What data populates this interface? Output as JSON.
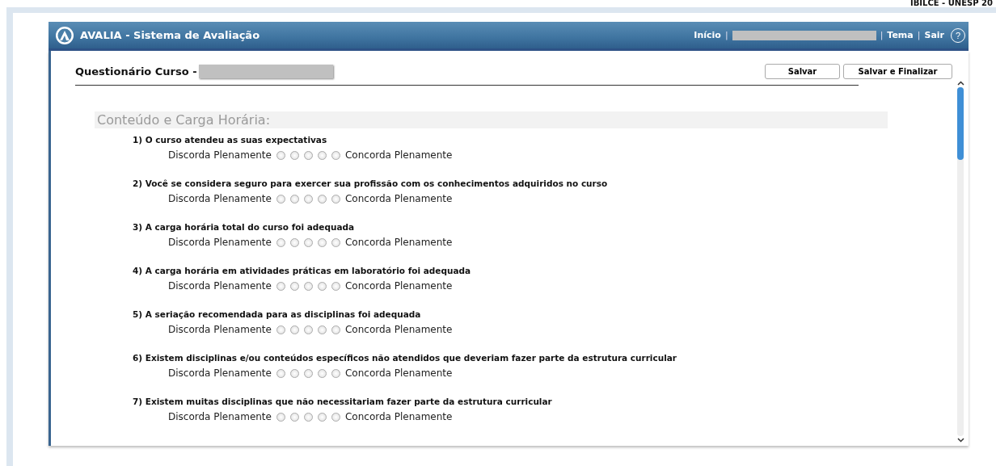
{
  "corner_text": "IBILCE - UNESP 20",
  "header": {
    "title": "AVALIA - Sistema de Avaliação",
    "links": [
      "Início",
      "Tema",
      "Sair"
    ],
    "separator": "|",
    "help": "?"
  },
  "form": {
    "title": "Questionário Curso -",
    "buttons": [
      "Salvar",
      "Salvar e Finalizar"
    ],
    "section": "Conteúdo e Carga Horária:",
    "questions": [
      {
        "text": "1) O curso atendeu as suas expectativas",
        "low": "Discorda Plenamente",
        "high": "Concorda Plenamente",
        "options": [
          {
            "selected": false
          },
          {
            "selected": false
          },
          {
            "selected": false
          },
          {
            "selected": false
          },
          {
            "selected": false
          }
        ]
      },
      {
        "text": "2) Você se considera seguro para exercer sua profissão com os conhecimentos adquiridos no curso",
        "low": "Discorda Plenamente",
        "high": "Concorda Plenamente",
        "options": [
          {
            "selected": false
          },
          {
            "selected": false
          },
          {
            "selected": false
          },
          {
            "selected": false
          },
          {
            "selected": false
          }
        ]
      },
      {
        "text": "3) A carga horária total do curso foi adequada",
        "low": "Discorda Plenamente",
        "high": "Concorda Plenamente",
        "options": [
          {
            "selected": false
          },
          {
            "selected": false
          },
          {
            "selected": false
          },
          {
            "selected": false
          },
          {
            "selected": false
          }
        ]
      },
      {
        "text": "4) A carga horária em atividades práticas em laboratório foi adequada",
        "low": "Discorda Plenamente",
        "high": "Concorda Plenamente",
        "options": [
          {
            "selected": false
          },
          {
            "selected": false
          },
          {
            "selected": false
          },
          {
            "selected": false
          },
          {
            "selected": false
          }
        ]
      },
      {
        "text": "5) A seriação recomendada para as disciplinas foi adequada",
        "low": "Discorda Plenamente",
        "high": "Concorda Plenamente",
        "options": [
          {
            "selected": false
          },
          {
            "selected": false
          },
          {
            "selected": false
          },
          {
            "selected": false
          },
          {
            "selected": false
          }
        ]
      },
      {
        "text": "6) Existem disciplinas e/ou conteúdos específicos não atendidos que deveriam fazer parte da estrutura curricular",
        "low": "Discorda Plenamente",
        "high": "Concorda Plenamente",
        "options": [
          {
            "selected": false
          },
          {
            "selected": false
          },
          {
            "selected": false
          },
          {
            "selected": false
          },
          {
            "selected": false
          }
        ]
      },
      {
        "text": "7) Existem muitas disciplinas que não necessitariam fazer parte da estrutura curricular",
        "low": "Discorda Plenamente",
        "high": "Concorda Plenamente",
        "options": [
          {
            "selected": false
          },
          {
            "selected": false
          },
          {
            "selected": false
          },
          {
            "selected": false
          },
          {
            "selected": false
          }
        ]
      }
    ]
  }
}
